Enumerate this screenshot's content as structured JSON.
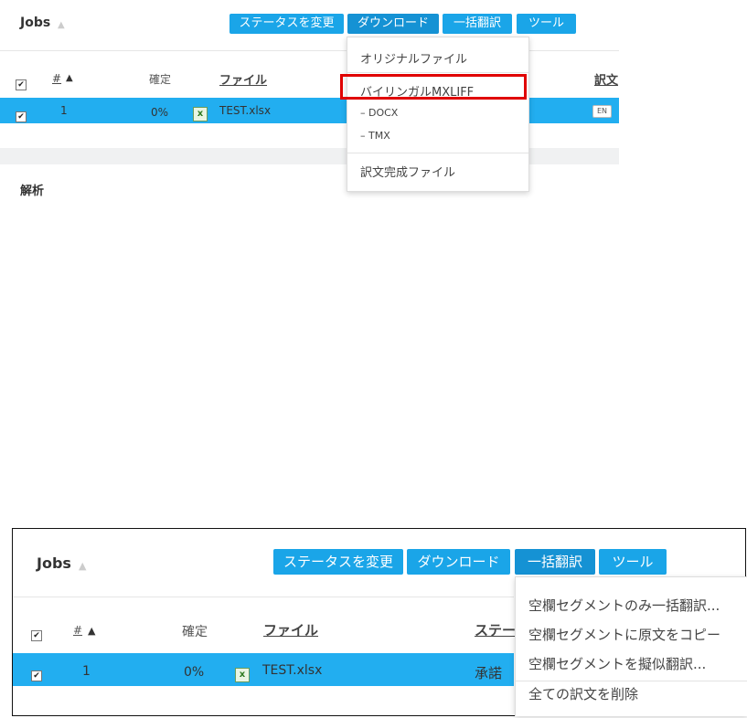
{
  "top": {
    "jobs_title": "Jobs",
    "buttons": [
      "ステータスを変更",
      "ダウンロード",
      "一括翻訳",
      "ツール"
    ],
    "headers": {
      "num": "#",
      "confirm": "確定",
      "file": "ファイル",
      "target": "訳文"
    },
    "row": {
      "num": "1",
      "pct": "0%",
      "file": "TEST.xlsx",
      "lang": "EN"
    },
    "menu": {
      "items": [
        "オリジナルファイル",
        "バイリンガルMXLIFF",
        "– DOCX",
        "– TMX",
        "訳文完成ファイル"
      ]
    },
    "section": "解析"
  },
  "bottom": {
    "jobs_title": "Jobs",
    "buttons": [
      "ステータスを変更",
      "ダウンロード",
      "一括翻訳",
      "ツール"
    ],
    "headers": {
      "num": "#",
      "confirm": "確定",
      "file": "ファイル",
      "status": "ステー"
    },
    "row": {
      "num": "1",
      "pct": "0%",
      "file": "TEST.xlsx",
      "status": "承諾"
    },
    "menu": {
      "items": [
        "空欄セグメントのみ一括翻訳...",
        "空欄セグメントに原文をコピー",
        "空欄セグメントを擬似翻訳...",
        "全ての訳文を削除"
      ]
    }
  },
  "colors": {
    "accent": "#1aa5e8",
    "row_selected": "#22aef0",
    "highlight": "#e00000"
  }
}
